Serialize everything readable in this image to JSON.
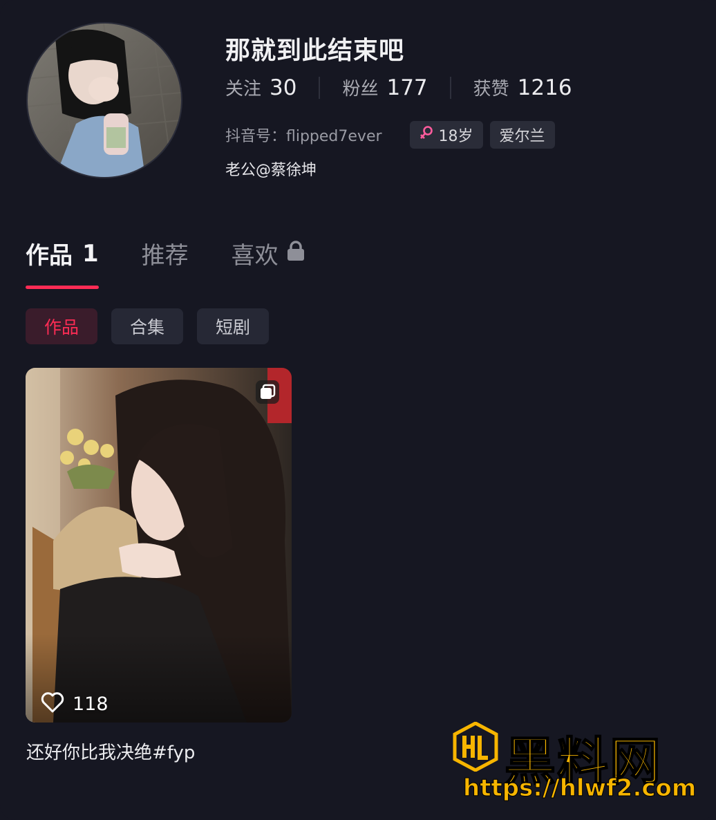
{
  "profile": {
    "username": "那就到此结束吧",
    "stats": [
      {
        "label": "关注",
        "value": "30"
      },
      {
        "label": "粉丝",
        "value": "177"
      },
      {
        "label": "获赞",
        "value": "1216"
      }
    ],
    "douyin_id": "抖音号：flipped7ever",
    "tags": {
      "age": "18岁",
      "location": "爱尔兰"
    },
    "bio": "老公@蔡徐坤"
  },
  "tabs": {
    "works_label": "作品",
    "works_count": "1",
    "recommend_label": "推荐",
    "likes_label": "喜欢"
  },
  "chips": [
    "作品",
    "合集",
    "短剧"
  ],
  "video": {
    "likes": "118",
    "caption": "还好你比我决绝#fyp"
  },
  "watermark": {
    "title": "黑料网",
    "url": "https://hlwf2.com"
  },
  "colors": {
    "background": "#161722",
    "accent": "#fe2c55",
    "female_icon": "#ff5c9d",
    "watermark": "#f7b500"
  }
}
